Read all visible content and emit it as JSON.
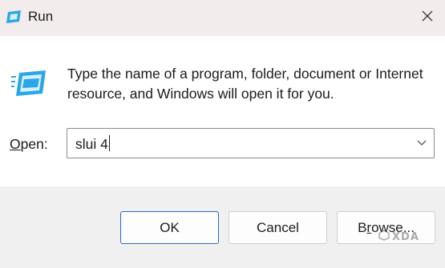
{
  "window": {
    "title": "Run",
    "close_icon": "close-icon",
    "app_icon": "run-app-icon"
  },
  "main": {
    "description": "Type the name of a program, folder, document or Internet resource, and Windows will open it for you.",
    "open_label_prefix": "O",
    "open_label_rest": "pen:",
    "open_value": "slui 4",
    "dropdown_icon": "chevron-down-icon"
  },
  "buttons": {
    "ok_label": "OK",
    "cancel_label": "Cancel",
    "browse_prefix": "B",
    "browse_underlined": "r",
    "browse_rest": "owse..."
  },
  "watermark": {
    "text": "XDA"
  },
  "colors": {
    "titlebar_bg": "#f3ecec",
    "footer_bg": "#f0f0f0",
    "accent_border": "#2a6ac8",
    "icon_blue": "#2aa7e8"
  }
}
